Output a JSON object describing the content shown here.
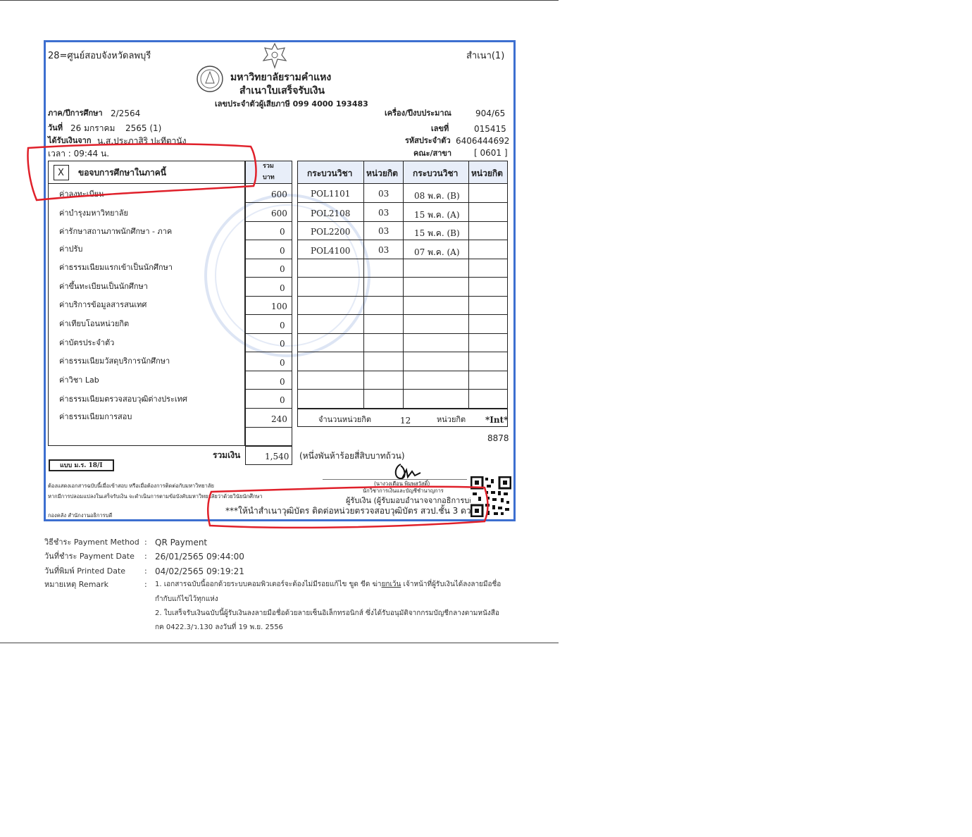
{
  "header": {
    "center_label": "28=ศูนย์สอบจังหวัดลพบุรี",
    "copy_label": "สำเนา(1)",
    "university": "มหาวิทยาลัยรามคำแหง",
    "doc_title": "สำเนาใบเสร็จรับเงิน",
    "tax_id": "เลขประจำตัวผู้เสียภาษี 099 4000 193483"
  },
  "info": {
    "term_label": "ภาค/ปีการศึกษา",
    "term_value": "2/2564",
    "date_label": "วันที่",
    "date_day": "26 มกราคม",
    "date_year": "2565 (1)",
    "payer_label": "ได้รับเงินจาก",
    "payer_value": "น.ส.ประภาสิริ ปะทีตานัง",
    "time_value": "เวลา : 09:44 น.",
    "machine_label": "เครื่อง/ปีงบประมาณ",
    "machine_value": "904/65",
    "no_label": "เลขที่",
    "no_value": "015415",
    "student_id_label": "รหัสประจำตัว",
    "student_id_value": "6406444692",
    "faculty_label": "คณะ/สาขา",
    "faculty_value": "[ 0601 ]"
  },
  "fees": {
    "checkbox_mark": "X",
    "heading": "ขอจบการศึกษาในภาคนี้",
    "col_total": "รวม",
    "col_baht": "บาท",
    "items": [
      {
        "label": "ค่าลงทะเบียน",
        "amount": "600"
      },
      {
        "label": "ค่าบำรุงมหาวิทยาลัย",
        "amount": "600"
      },
      {
        "label": "ค่ารักษาสถานภาพนักศึกษา        -        ภาค",
        "amount": "0"
      },
      {
        "label": "ค่าปรับ",
        "amount": "0"
      },
      {
        "label": "ค่าธรรมเนียมแรกเข้าเป็นนักศึกษา",
        "amount": "0"
      },
      {
        "label": "ค่าขึ้นทะเบียนเป็นนักศึกษา",
        "amount": "0"
      },
      {
        "label": "ค่าบริการข้อมูลสารสนเทศ",
        "amount": "100"
      },
      {
        "label": "ค่าเทียบโอนหน่วยกิต",
        "amount": "0"
      },
      {
        "label": "ค่าบัตรประจำตัว",
        "amount": "0"
      },
      {
        "label": "ค่าธรรมเนียมวัสดุบริการนักศึกษา",
        "amount": "0"
      },
      {
        "label": "ค่าวิชา Lab",
        "amount": "0"
      },
      {
        "label": "ค่าธรรมเนียมตรวจสอบวุฒิต่างประเทศ",
        "amount": "0"
      },
      {
        "label": "ค่าธรรมเนียมการสอบ",
        "amount": "240"
      }
    ],
    "total_label": "รวมเงิน",
    "total_value": "1,540",
    "total_words": "(หนึ่งพันห้าร้อยสี่สิบบาทถ้วน)"
  },
  "courses": {
    "col_course": "กระบวนวิชา",
    "col_credit": "หน่วยกิต",
    "left": [
      {
        "code": "POL1101",
        "credit": "03"
      },
      {
        "code": "POL2108",
        "credit": "03"
      },
      {
        "code": "POL2200",
        "credit": "03"
      },
      {
        "code": "POL4100",
        "credit": "03"
      }
    ],
    "right": [
      {
        "code": "08 พ.ค. (B)"
      },
      {
        "code": "15 พ.ค. (A)"
      },
      {
        "code": "15 พ.ค. (B)"
      },
      {
        "code": "07 พ.ค. (A)"
      }
    ],
    "credits_label": "จำนวนหน่วยกิต",
    "credits_value": "12",
    "credits_unit": "หน่วยกิต",
    "int_label": "*Int*",
    "ref_number": "8878"
  },
  "bottom": {
    "form_label": "แบบ ม.ร. 18/I",
    "note_line1": "ต้องแสดงเอกสารฉบับนี้เมื่อเข้าสอบ หรือเมื่อต้องการติดต่อกับมหาวิทยาลัย",
    "note_line2": "หากมีการปลอมแปลงในเสร็จรับเงิน จะดำเนินการตามข้อบังคับมหาวิทยาลัยว่าด้วยวินัยนักศึกษา",
    "dept": "กองคลัง สำนักงานอธิการบดี",
    "signer_name": "(นางวงเดือน พิมพสวัสดิ์)",
    "signer_title": "นักวิชาการเงินและบัญชีชำนาญการ",
    "receiver_label": "ผู้รับเงิน (ผู้รับมอบอำนาจจากอธิการบดี)",
    "notice": "***ให้นำสำเนาวุฒิบัตร ติดต่อหน่วยตรวจสอบวุฒิบัตร สวป.ชั้น 3 ดวน"
  },
  "footer": {
    "method_label": "วิธีชำระ Payment Method",
    "method_value": "QR Payment",
    "pay_date_label": "วันที่ชำระ Payment Date",
    "pay_date_value": "26/01/2565 09:44:00",
    "print_date_label": "วันที่พิมพ์ Printed Date",
    "print_date_value": "04/02/2565 09:19:21",
    "remark_label": "หมายเหตุ Remark",
    "remark1_a": "1. เอกสารฉบับนี้ออกด้วยระบบคอมพิวเตอร์จะต้องไม่มีรอยแก้ไข ขูด ขีด ฆ่า",
    "remark1_u": "ยกเว้น",
    "remark1_b": " เจ้าหน้าที่ผู้รับเงินได้ลงลายมือชื่อ",
    "remark1_c": "กำกับแก้ไขไว้ทุกแห่ง",
    "remark2_a": "2. ใบเสร็จรับเงินฉบับนี้ผู้รับเงินลงลายมือชื่อด้วยลายเซ็นอิเล็กทรอนิกส์ ซึ่งได้รับอนุมัติจากกรมบัญชีกลางตามหนังสือ",
    "remark2_b": "กค 0422.3/ว.130 ลงวันที่ 19 พ.ย. 2556",
    "colon": ":"
  }
}
